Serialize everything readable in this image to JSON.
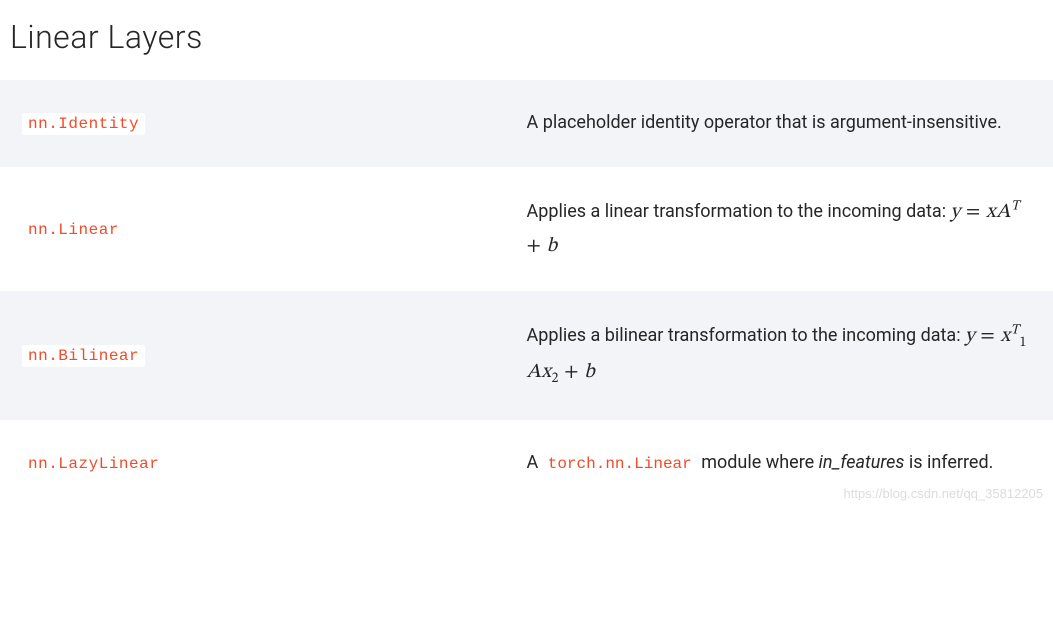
{
  "title": "Linear Layers",
  "rows": [
    {
      "api": "nn.Identity",
      "desc_type": "plain",
      "desc": "A placeholder identity operator that is argument-insensitive."
    },
    {
      "api": "nn.Linear",
      "desc_type": "linear",
      "prefix": "Applies a linear transformation to the incoming data: ",
      "formula": "y = xA^T + b"
    },
    {
      "api": "nn.Bilinear",
      "desc_type": "bilinear",
      "prefix": "Applies a bilinear transformation to the incoming data: ",
      "formula": "y = x_1^T A x_2 + b"
    },
    {
      "api": "nn.LazyLinear",
      "desc_type": "lazy",
      "desc_a": "A ",
      "code": "torch.nn.Linear",
      "desc_b": " module where ",
      "arg": "in_features",
      "desc_c": " is inferred."
    }
  ],
  "watermark": "https://blog.csdn.net/qq_35812205"
}
